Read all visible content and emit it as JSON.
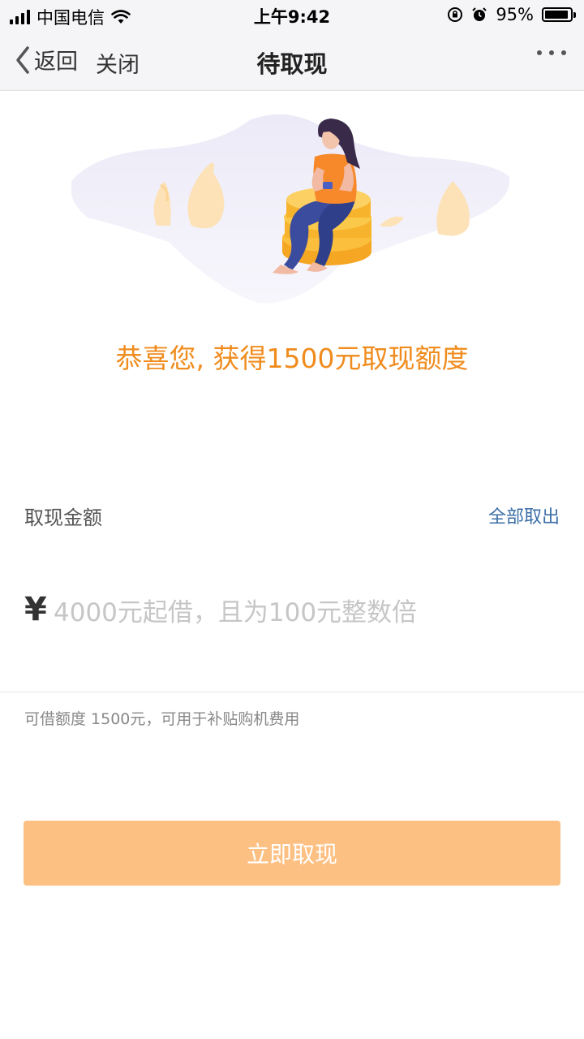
{
  "status_bar": {
    "carrier": "中国电信",
    "time": "上午9:42",
    "battery": "95%"
  },
  "nav": {
    "back_label": "返回",
    "close_label": "关闭",
    "title": "待取现"
  },
  "main": {
    "congrats": "恭喜您, 获得1500元取现额度",
    "amount_label": "取现金额",
    "withdraw_all": "全部取出",
    "currency_symbol": "¥",
    "amount_placeholder": "4000元起借，且为100元整数倍",
    "hint": "可借额度 1500元，可用于补贴购机费用",
    "submit_label": "立即取现"
  },
  "colors": {
    "accent_orange": "#f08c1e",
    "button_disabled": "#fdc083",
    "link_blue": "#3d6fa8"
  }
}
